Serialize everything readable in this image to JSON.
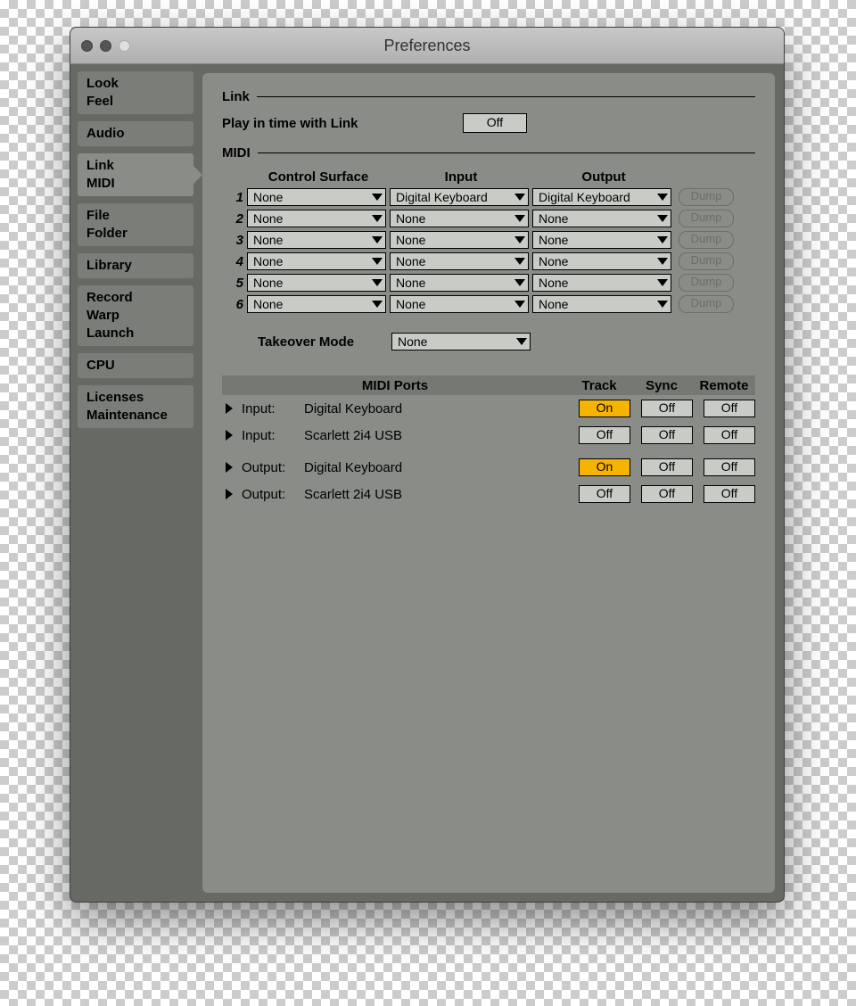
{
  "window": {
    "title": "Preferences"
  },
  "sidebar": [
    {
      "lines": [
        "Look",
        "Feel"
      ],
      "selected": false
    },
    {
      "lines": [
        "Audio"
      ],
      "selected": false
    },
    {
      "lines": [
        "Link",
        "MIDI"
      ],
      "selected": true
    },
    {
      "lines": [
        "File",
        "Folder"
      ],
      "selected": false
    },
    {
      "lines": [
        "Library"
      ],
      "selected": false
    },
    {
      "lines": [
        "Record",
        "Warp",
        "Launch"
      ],
      "selected": false
    },
    {
      "lines": [
        "CPU"
      ],
      "selected": false
    },
    {
      "lines": [
        "Licenses",
        "Maintenance"
      ],
      "selected": false
    }
  ],
  "link": {
    "section_label": "Link",
    "play_label": "Play in time with Link",
    "play_value": "Off"
  },
  "midi": {
    "section_label": "MIDI",
    "headers": {
      "cs": "Control Surface",
      "in": "Input",
      "out": "Output"
    },
    "rows": [
      {
        "n": "1",
        "cs": "None",
        "in": "Digital Keyboard",
        "out": "Digital Keyboard",
        "dump": "Dump"
      },
      {
        "n": "2",
        "cs": "None",
        "in": "None",
        "out": "None",
        "dump": "Dump"
      },
      {
        "n": "3",
        "cs": "None",
        "in": "None",
        "out": "None",
        "dump": "Dump"
      },
      {
        "n": "4",
        "cs": "None",
        "in": "None",
        "out": "None",
        "dump": "Dump"
      },
      {
        "n": "5",
        "cs": "None",
        "in": "None",
        "out": "None",
        "dump": "Dump"
      },
      {
        "n": "6",
        "cs": "None",
        "in": "None",
        "out": "None",
        "dump": "Dump"
      }
    ],
    "takeover": {
      "label": "Takeover Mode",
      "value": "None"
    },
    "ports_header": {
      "name": "MIDI Ports",
      "track": "Track",
      "sync": "Sync",
      "remote": "Remote"
    },
    "ports": [
      {
        "type": "Input:",
        "name": "Digital Keyboard",
        "track": "On",
        "sync": "Off",
        "remote": "Off"
      },
      {
        "type": "Input:",
        "name": "Scarlett 2i4 USB",
        "track": "Off",
        "sync": "Off",
        "remote": "Off"
      },
      {
        "type": "Output:",
        "name": "Digital Keyboard",
        "track": "On",
        "sync": "Off",
        "remote": "Off"
      },
      {
        "type": "Output:",
        "name": "Scarlett 2i4 USB",
        "track": "Off",
        "sync": "Off",
        "remote": "Off"
      }
    ]
  }
}
